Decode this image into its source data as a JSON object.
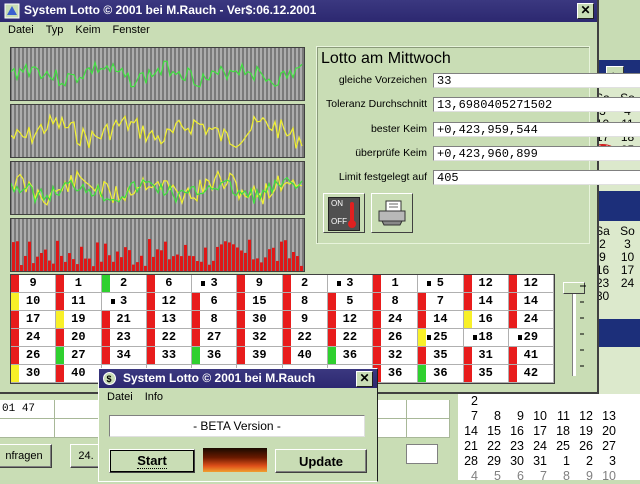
{
  "main_window": {
    "title": "System Lotto © 2001 bei M.Rauch - Ver$:06.12.2001",
    "menu": [
      "Datei",
      "Typ",
      "Keim",
      "Fenster"
    ],
    "close_icon": "close-icon"
  },
  "lotto_panel": {
    "heading": "Lotto am Mittwoch",
    "fields": [
      {
        "label": "gleiche Vorzeichen",
        "value": "33"
      },
      {
        "label": "Toleranz Durchschnitt",
        "value": "13,6980405271502"
      },
      {
        "label": "bester Keim",
        "value": "+0,423,959,544"
      },
      {
        "label": "überprüfe Keim",
        "value": "+0,423,960,899"
      },
      {
        "label": "Limit festgelegt auf",
        "value": "405"
      }
    ],
    "switch_on": "ON",
    "switch_off": "OFF",
    "printer_icon": "printer-icon"
  },
  "number_grid": {
    "rows": [
      [
        "9",
        "1",
        "2",
        "6",
        "3",
        "9",
        "2",
        "3",
        "1",
        "5",
        "12",
        "12"
      ],
      [
        "10",
        "11",
        "3",
        "12",
        "6",
        "15",
        "8",
        "5",
        "8",
        "7",
        "14",
        "14"
      ],
      [
        "17",
        "19",
        "21",
        "13",
        "8",
        "30",
        "9",
        "12",
        "24",
        "14",
        "16",
        "24"
      ],
      [
        "24",
        "20",
        "23",
        "22",
        "27",
        "32",
        "22",
        "22",
        "26",
        "25",
        "18",
        "29"
      ],
      [
        "26",
        "27",
        "34",
        "33",
        "36",
        "39",
        "40",
        "36",
        "32",
        "35",
        "31",
        "41"
      ],
      [
        "30",
        "40",
        "",
        "",
        "",
        "",
        "",
        "",
        "36",
        "36",
        "35",
        "42"
      ]
    ],
    "markers": [
      [
        "red",
        "red",
        "green",
        "red",
        "dot",
        "red",
        "red",
        "dot",
        "red",
        "dot",
        "red",
        "red"
      ],
      [
        "yellow",
        "red",
        "dot",
        "red",
        "red",
        "red",
        "red",
        "red",
        "red",
        "red",
        "red",
        "red"
      ],
      [
        "red",
        "yellow",
        "red",
        "red",
        "red",
        "red",
        "red",
        "red",
        "red",
        "red",
        "yellow",
        "red"
      ],
      [
        "red",
        "red",
        "red",
        "red",
        "red",
        "red",
        "red",
        "red",
        "red",
        "yellowdot",
        "dot",
        "dot"
      ],
      [
        "red",
        "green",
        "red",
        "red",
        "green",
        "red",
        "red",
        "green",
        "red",
        "red",
        "red",
        "red"
      ],
      [
        "yellow",
        "red",
        "",
        "",
        "",
        "",
        "",
        "",
        "red",
        "green",
        "red",
        "red"
      ]
    ],
    "colors": {
      "red": "#e81c1c",
      "green": "#2fd02f",
      "yellow": "#f8f028"
    }
  },
  "dialog": {
    "title": "System Lotto © 2001 bei M.Rauch",
    "menu": [
      "Datei",
      "Info"
    ],
    "version_text": "- BETA Version -",
    "start_label": "Start",
    "update_label": "Update"
  },
  "background_window": {
    "row_values": [
      "01",
      "47"
    ],
    "button_anfragen": "nfragen",
    "button_24": "24."
  },
  "calendar_right": {
    "headers": [
      "Sa",
      "So"
    ],
    "week_rows": [
      [
        "3",
        "4"
      ],
      [
        "10",
        "11"
      ],
      [
        "17",
        "18"
      ],
      [
        "24",
        "25"
      ]
    ],
    "week_rows_2": [
      [
        "2",
        "3"
      ],
      [
        "9",
        "10"
      ],
      [
        "16",
        "17"
      ],
      [
        "23",
        "24"
      ],
      [
        "30",
        ""
      ]
    ],
    "highlight_day": "24"
  },
  "calendar_bottom": {
    "rows": [
      [
        "",
        "",
        "",
        "",
        "",
        "",
        ""
      ],
      [
        "7",
        "8",
        "9",
        "10",
        "11",
        "12",
        "13"
      ],
      [
        "14",
        "15",
        "16",
        "17",
        "18",
        "19",
        "20"
      ],
      [
        "21",
        "22",
        "23",
        "24",
        "25",
        "26",
        "27"
      ],
      [
        "28",
        "29",
        "30",
        "31",
        "1",
        "2",
        "3"
      ],
      [
        "4",
        "5",
        "6",
        "7",
        "8",
        "9",
        "10"
      ]
    ],
    "first_row": [
      "2"
    ]
  }
}
